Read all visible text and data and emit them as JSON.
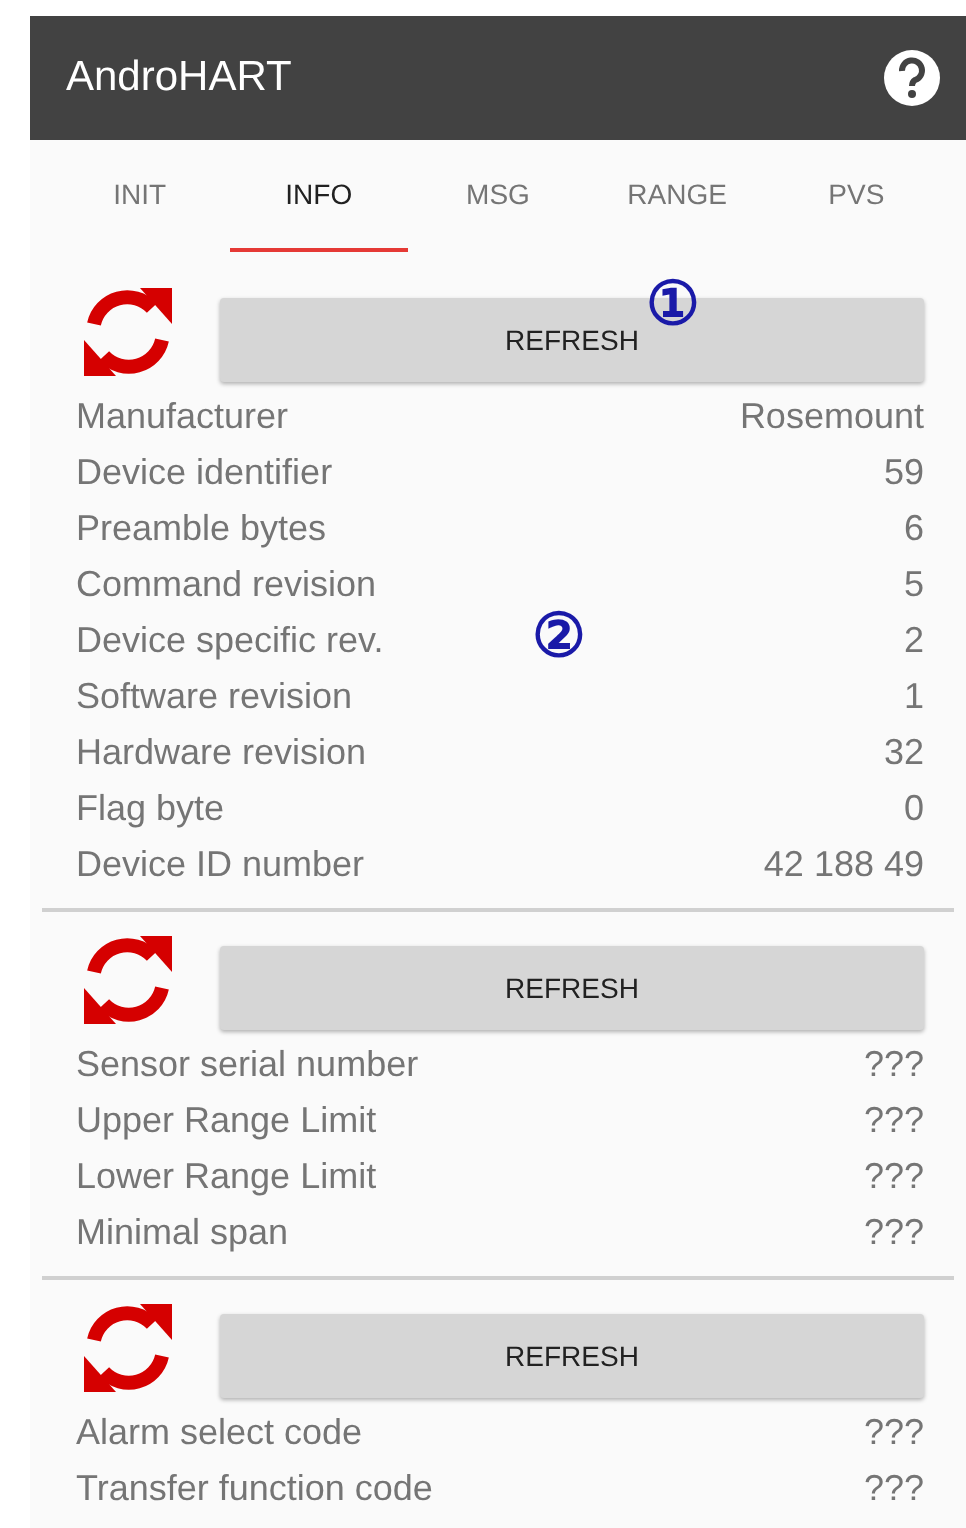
{
  "app_bar": {
    "title": "AndroHART"
  },
  "tabs": [
    {
      "label": "INIT",
      "selected": false
    },
    {
      "label": "INFO",
      "selected": true
    },
    {
      "label": "MSG",
      "selected": false
    },
    {
      "label": "RANGE",
      "selected": false
    },
    {
      "label": "PVS",
      "selected": false
    }
  ],
  "sections": [
    {
      "button": "REFRESH",
      "callout": "①",
      "rows": [
        {
          "label": "Manufacturer",
          "value": "Rosemount"
        },
        {
          "label": "Device identifier",
          "value": "59"
        },
        {
          "label": "Preamble bytes",
          "value": "6"
        },
        {
          "label": "Command revision",
          "value": "5"
        },
        {
          "label": "Device specific rev.",
          "value": "2",
          "callout": "②"
        },
        {
          "label": "Software revision",
          "value": "1"
        },
        {
          "label": "Hardware revision",
          "value": "32"
        },
        {
          "label": "Flag byte",
          "value": "0"
        },
        {
          "label": "Device ID number",
          "value": "42 188 49"
        }
      ]
    },
    {
      "button": "REFRESH",
      "rows": [
        {
          "label": "Sensor serial number",
          "value": "???"
        },
        {
          "label": "Upper Range Limit",
          "value": "???"
        },
        {
          "label": "Lower Range Limit",
          "value": "???"
        },
        {
          "label": "Minimal span",
          "value": "???"
        }
      ]
    },
    {
      "button": "REFRESH",
      "rows": [
        {
          "label": "Alarm select code",
          "value": "???"
        },
        {
          "label": "Transfer function code",
          "value": "???"
        }
      ]
    }
  ]
}
